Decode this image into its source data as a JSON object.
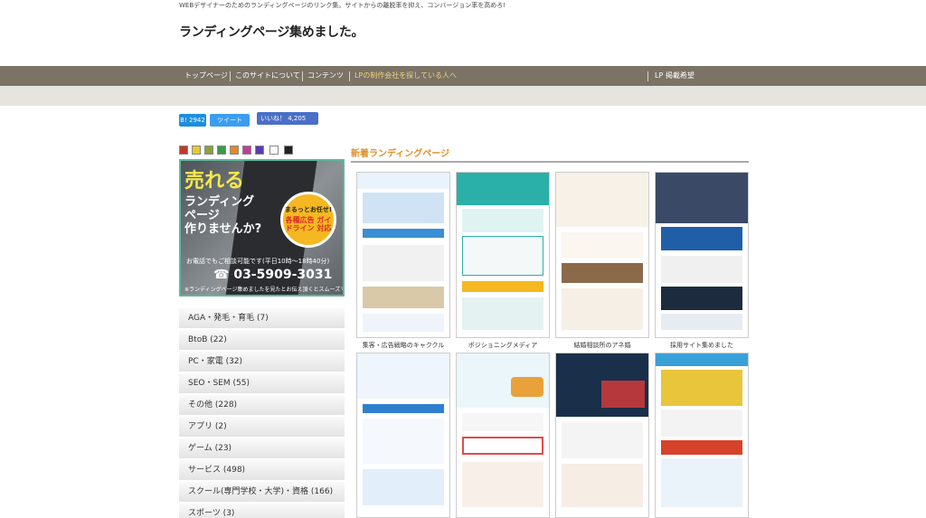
{
  "header": {
    "tagline": "WEBデザイナーのためのランディングページのリンク集。サイトからの離脱率を抑え、コンバージョン率を高めろ!",
    "title": "ランディングページ集めました。"
  },
  "nav": {
    "items": [
      {
        "label": "トップページ"
      },
      {
        "label": "このサイトについて"
      },
      {
        "label": "コンテンツ"
      },
      {
        "label": "LPの制作会社を探している人へ"
      }
    ],
    "right_label": "LP 掲載希望"
  },
  "social": {
    "hatena": "B! 2942",
    "tweet": "ツイート",
    "like": "いいね！ 4,205"
  },
  "colors": {
    "nav_bg": "#7a7366",
    "nav_highlight": "#f4d27a",
    "section_title": "#e0902a",
    "swatches": [
      "#c0392b",
      "#e6c82e",
      "#8aa23a",
      "#3b9a4a",
      "#e08a2a",
      "#c23b9a",
      "#5a3bb0",
      "#ffffff",
      "#222222"
    ]
  },
  "banner": {
    "line1": "売れる",
    "line2a": "ランディング",
    "line2b": "ページ",
    "line2c": "作りませんか?",
    "badge_top": "まるっとお任せ!",
    "badge_main": "各種広告 ガイドライン 対応",
    "call": "お電話でもご相談可能です(平日10時〜18時40分)",
    "phone": "03-5909-3031",
    "note": "※ランディングページ集めましたを見たとお伝え頂くとスムーズです"
  },
  "categories": [
    {
      "label": "AGA・発毛・育毛 (7)"
    },
    {
      "label": "BtoB (22)"
    },
    {
      "label": "PC・家電 (32)"
    },
    {
      "label": "SEO・SEM (55)"
    },
    {
      "label": "その他 (228)"
    },
    {
      "label": "アプリ (2)"
    },
    {
      "label": "ゲーム (23)"
    },
    {
      "label": "サービス (498)"
    },
    {
      "label": "スクール(専門学校・大学)・資格 (166)"
    },
    {
      "label": "スポーツ (3)"
    }
  ],
  "main": {
    "section_title": "新着ランディングページ",
    "cards": [
      {
        "label": "集客・広告戦略のキャククル",
        "accent": "#3a8fd4"
      },
      {
        "label": "ポジショニングメディア",
        "accent": "#2ab0a8"
      },
      {
        "label": "結婚相談所のアネ婚",
        "accent": "#d9a66b"
      },
      {
        "label": "採用サイト集めました",
        "accent": "#1f5fa8"
      },
      {
        "label": "",
        "accent": "#2f7fd0"
      },
      {
        "label": "",
        "accent": "#e9a23a"
      },
      {
        "label": "",
        "accent": "#d43a3a"
      },
      {
        "label": "",
        "accent": "#e8c53a"
      }
    ]
  }
}
